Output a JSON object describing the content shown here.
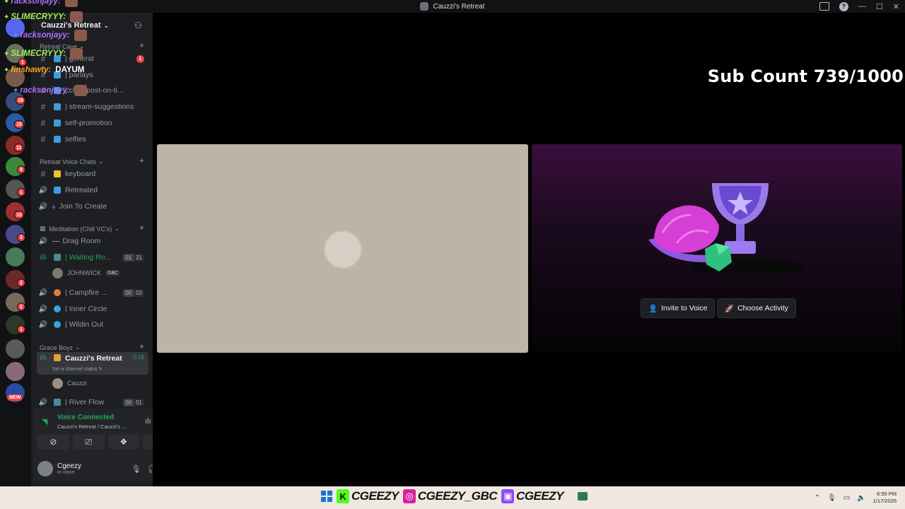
{
  "window": {
    "title": "Cauzzi's Retreat"
  },
  "server": {
    "name": "Cauzzi's Retreat"
  },
  "rail_badges": [
    "7",
    "1",
    "19",
    "15",
    "11",
    "9",
    "1",
    "10",
    "3",
    "5",
    "2",
    "2",
    "1"
  ],
  "rail_new_badge": "NEW",
  "categories": {
    "text": "Retreat Cave",
    "voice": "Retreat Voice Chats",
    "meditation": "Meditation (Chill VC's)",
    "grace": "Grace Boyz"
  },
  "text_channels": [
    {
      "label": "| general",
      "mention": "1"
    },
    {
      "label": "| parlays"
    },
    {
      "label": "| clips-post-on-ti..."
    },
    {
      "label": "| stream-suggestions"
    },
    {
      "label": "self-promotion"
    },
    {
      "label": "selfies"
    }
  ],
  "voice_channels": {
    "keyboard": "keyboard",
    "retreated": "Retreated",
    "join": "Join To Create",
    "drag": "Drag Room",
    "waiting": "| Waiting Ro...",
    "waiting_count": [
      "01",
      "21"
    ],
    "waiting_member": "JOHNWICK",
    "waiting_member_tag": "GBC",
    "campfire": "| Campfire ...",
    "campfire_count": [
      "00",
      "03"
    ],
    "inner": "| Inner Circle",
    "wildin": "| Wildin Out",
    "cauzzi": "Cauzzi's Retreat",
    "cauzzi_timer": "0:16",
    "cauzzi_status": "Set a channel status",
    "cauzzi_member": "Cauzzi",
    "river": "| River Flow",
    "river_count": [
      "00",
      "01"
    ]
  },
  "voice_panel": {
    "title": "Voice Connected",
    "subtitle": "Cauzzi's Retreat / Cauzzi's ..."
  },
  "user": {
    "name": "Cgeezy",
    "status": "In voice"
  },
  "overlay": {
    "sub_count": "Sub Count 739/1000"
  },
  "chat": [
    {
      "user": "racksonjayy:",
      "color": "#a970ff",
      "msg": ""
    },
    {
      "user": "SLIMECRYYY:",
      "color": "#9df25a",
      "msg": ""
    },
    {
      "user": "racksonjayy:",
      "color": "#a970ff",
      "msg": ""
    },
    {
      "user": "SLIMECRYYY:",
      "color": "#9df25a",
      "msg": ""
    },
    {
      "user": "finshawty:",
      "color": "#f5a623",
      "msg": "DAYUM"
    },
    {
      "user": "racksonjayy:",
      "color": "#a970ff",
      "msg": ""
    }
  ],
  "activity": {
    "invite_label": "Invite to Voice",
    "choose_label": "Choose Activity"
  },
  "taskbar": {
    "kick": "CGEEZY",
    "instagram": "CGEEZY_GBC",
    "twitch": "CGEEZY",
    "time": "6:55 PM",
    "date": "1/17/2026"
  },
  "colors": {
    "accent_green": "#23a55a",
    "mention_red": "#f23f43",
    "twitch_purple": "#9146ff",
    "kick_green": "#53fc18"
  }
}
